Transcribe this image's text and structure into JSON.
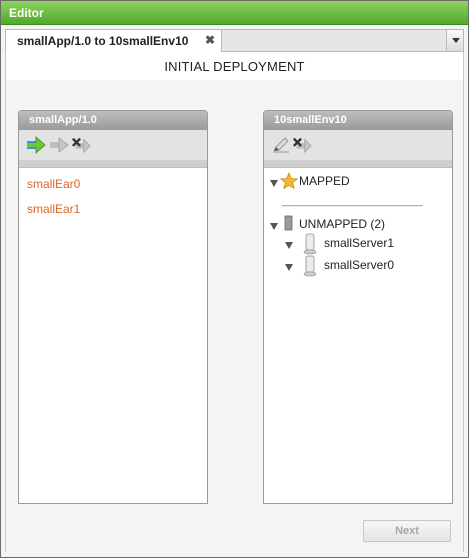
{
  "window": {
    "title": "Editor"
  },
  "tabs": [
    {
      "label": "smallApp/1.0 to 10smallEnv10",
      "close": "✖"
    }
  ],
  "main": {
    "heading": "INITIAL DEPLOYMENT"
  },
  "left_panel": {
    "title": "smallApp/1.0",
    "toolbar": [
      "map-arrow-icon",
      "unmap-arrow-icon",
      "remove-mapping-icon"
    ],
    "items": [
      "smallEar0",
      "smallEar1"
    ]
  },
  "right_panel": {
    "title": "10smallEnv10",
    "toolbar": [
      "edit-pencil-icon",
      "delete-mapping-icon"
    ],
    "mapped": {
      "label": "MAPPED"
    },
    "divider": "_______________________",
    "unmapped": {
      "label": "UNMAPPED (2)",
      "children": [
        "smallServer1",
        "smallServer0"
      ]
    }
  },
  "footer": {
    "next_label": "Next"
  },
  "colors": {
    "title_green": "#5cb233",
    "link_orange": "#e0662a",
    "panel_header_gray": "#a9a9a9"
  }
}
